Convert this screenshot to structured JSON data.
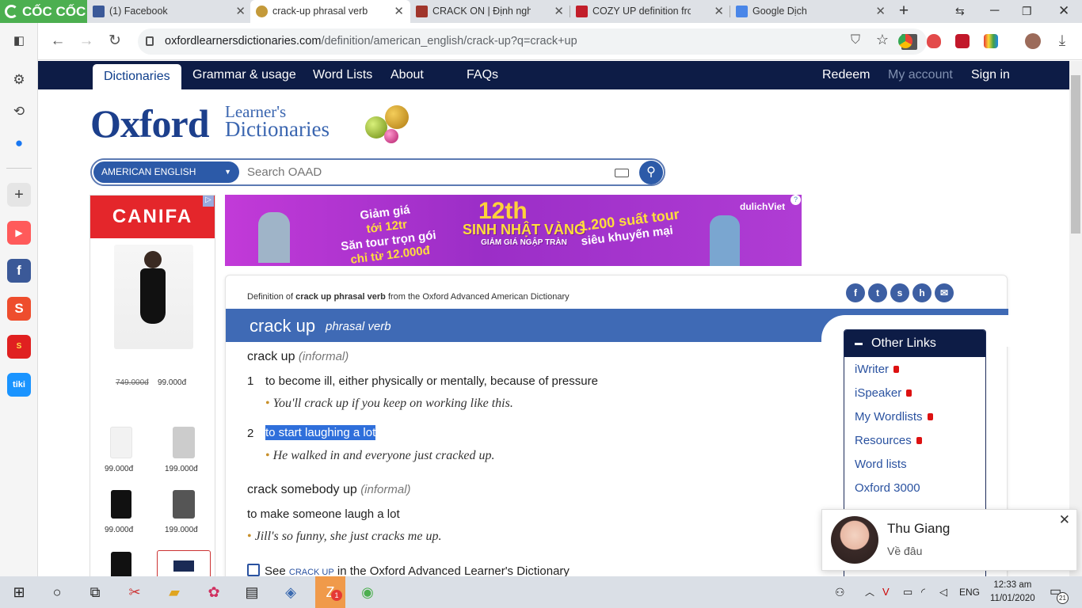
{
  "browser": {
    "brand_label": "CỐC CỐC",
    "tabs": [
      {
        "title": "(1) Facebook",
        "icon": "facebook-icon",
        "active": false
      },
      {
        "title": "crack-up phrasal verb - Definition",
        "icon": "oxford-icon",
        "active": true
      },
      {
        "title": "CRACK ON | Định nghĩa trong",
        "icon": "cambridge-icon",
        "active": false
      },
      {
        "title": "COZY UP definition from Macmillan",
        "icon": "macmillan-icon",
        "active": false
      },
      {
        "title": "Google Dịch",
        "icon": "google-translate-icon",
        "active": false
      }
    ],
    "new_tab_label": "+",
    "url_host": "oxfordlearnersdictionaries.com",
    "url_path": "/definition/american_english/crack-up?q=crack+up"
  },
  "site": {
    "nav": [
      "Dictionaries",
      "Grammar & usage",
      "Word Lists",
      "About",
      "FAQs"
    ],
    "account": [
      "Redeem",
      "My account",
      "Sign in"
    ],
    "logo_main": "Oxford",
    "logo_sub1": "Learner's",
    "logo_sub2": "Dictionaries",
    "dict_select": "AMERICAN ENGLISH",
    "search_placeholder": "Search OAAD"
  },
  "ads": {
    "left_brand": "CANIFA",
    "left_old_price": "749.000đ",
    "left_price": "99.000đ",
    "left_items": [
      {
        "price": "99.000đ"
      },
      {
        "price": "199.000đ"
      },
      {
        "price": "99.000đ"
      },
      {
        "price": "199.000đ"
      }
    ],
    "banner_line1": "Giảm giá",
    "banner_line2": "tới 12tr",
    "banner_line3": "Săn tour trọn gói",
    "banner_line4": "chỉ từ 12.000đ",
    "banner_number": "12th",
    "banner_center": "SINH NHẬT VÀNG",
    "banner_center_sub": "GIẢM GIÁ NGẬP TRÀN",
    "banner_right1": "1.200 suất tour",
    "banner_right2": "siêu khuyến mại",
    "banner_brand": "dulichViet"
  },
  "entry": {
    "definition_of_prefix": "Definition of ",
    "definition_of_word": "crack up phrasal verb",
    "definition_of_suffix": " from the Oxford Advanced American Dictionary",
    "headword": "crack up",
    "pos": "phrasal verb",
    "sense_groups": [
      {
        "phrase": "crack up",
        "label": "(informal)",
        "senses": [
          {
            "num": "1",
            "def": "to become ill, either physically or mentally, because of pressure",
            "example": "You'll crack up if you keep on working like this."
          },
          {
            "num": "2",
            "def": "to start laughing a lot",
            "example": "He walked in and everyone just cracked up."
          }
        ]
      },
      {
        "phrase": "crack somebody up",
        "label": "(informal)",
        "def": "to make someone laugh a lot",
        "example": "Jill's so funny, she just cracks me up."
      }
    ],
    "see_prefix": "See",
    "see_link": "CRACK UP",
    "see_suffix": "in the Oxford Advanced Learner's Dictionary"
  },
  "other_links": {
    "title": "Other Links",
    "items": [
      {
        "label": "iWriter",
        "locked": true
      },
      {
        "label": "iSpeaker",
        "locked": true
      },
      {
        "label": "My Wordlists",
        "locked": true
      },
      {
        "label": "Resources",
        "locked": true
      },
      {
        "label": "Word lists",
        "locked": false
      },
      {
        "label": "Oxford 3000",
        "locked": false
      }
    ]
  },
  "chat": {
    "name": "Thu Giang",
    "message": "Về đâu"
  },
  "taskbar": {
    "zalo_badge": "1",
    "language": "ENG",
    "time": "12:33 am",
    "date": "11/01/2020",
    "notification_count": "21"
  },
  "colors": {
    "oxford_navy": "#0d1c46",
    "oxford_blue": "#3f6ab5",
    "selection": "#2f6fdb",
    "coccoc_green": "#4caf50"
  }
}
